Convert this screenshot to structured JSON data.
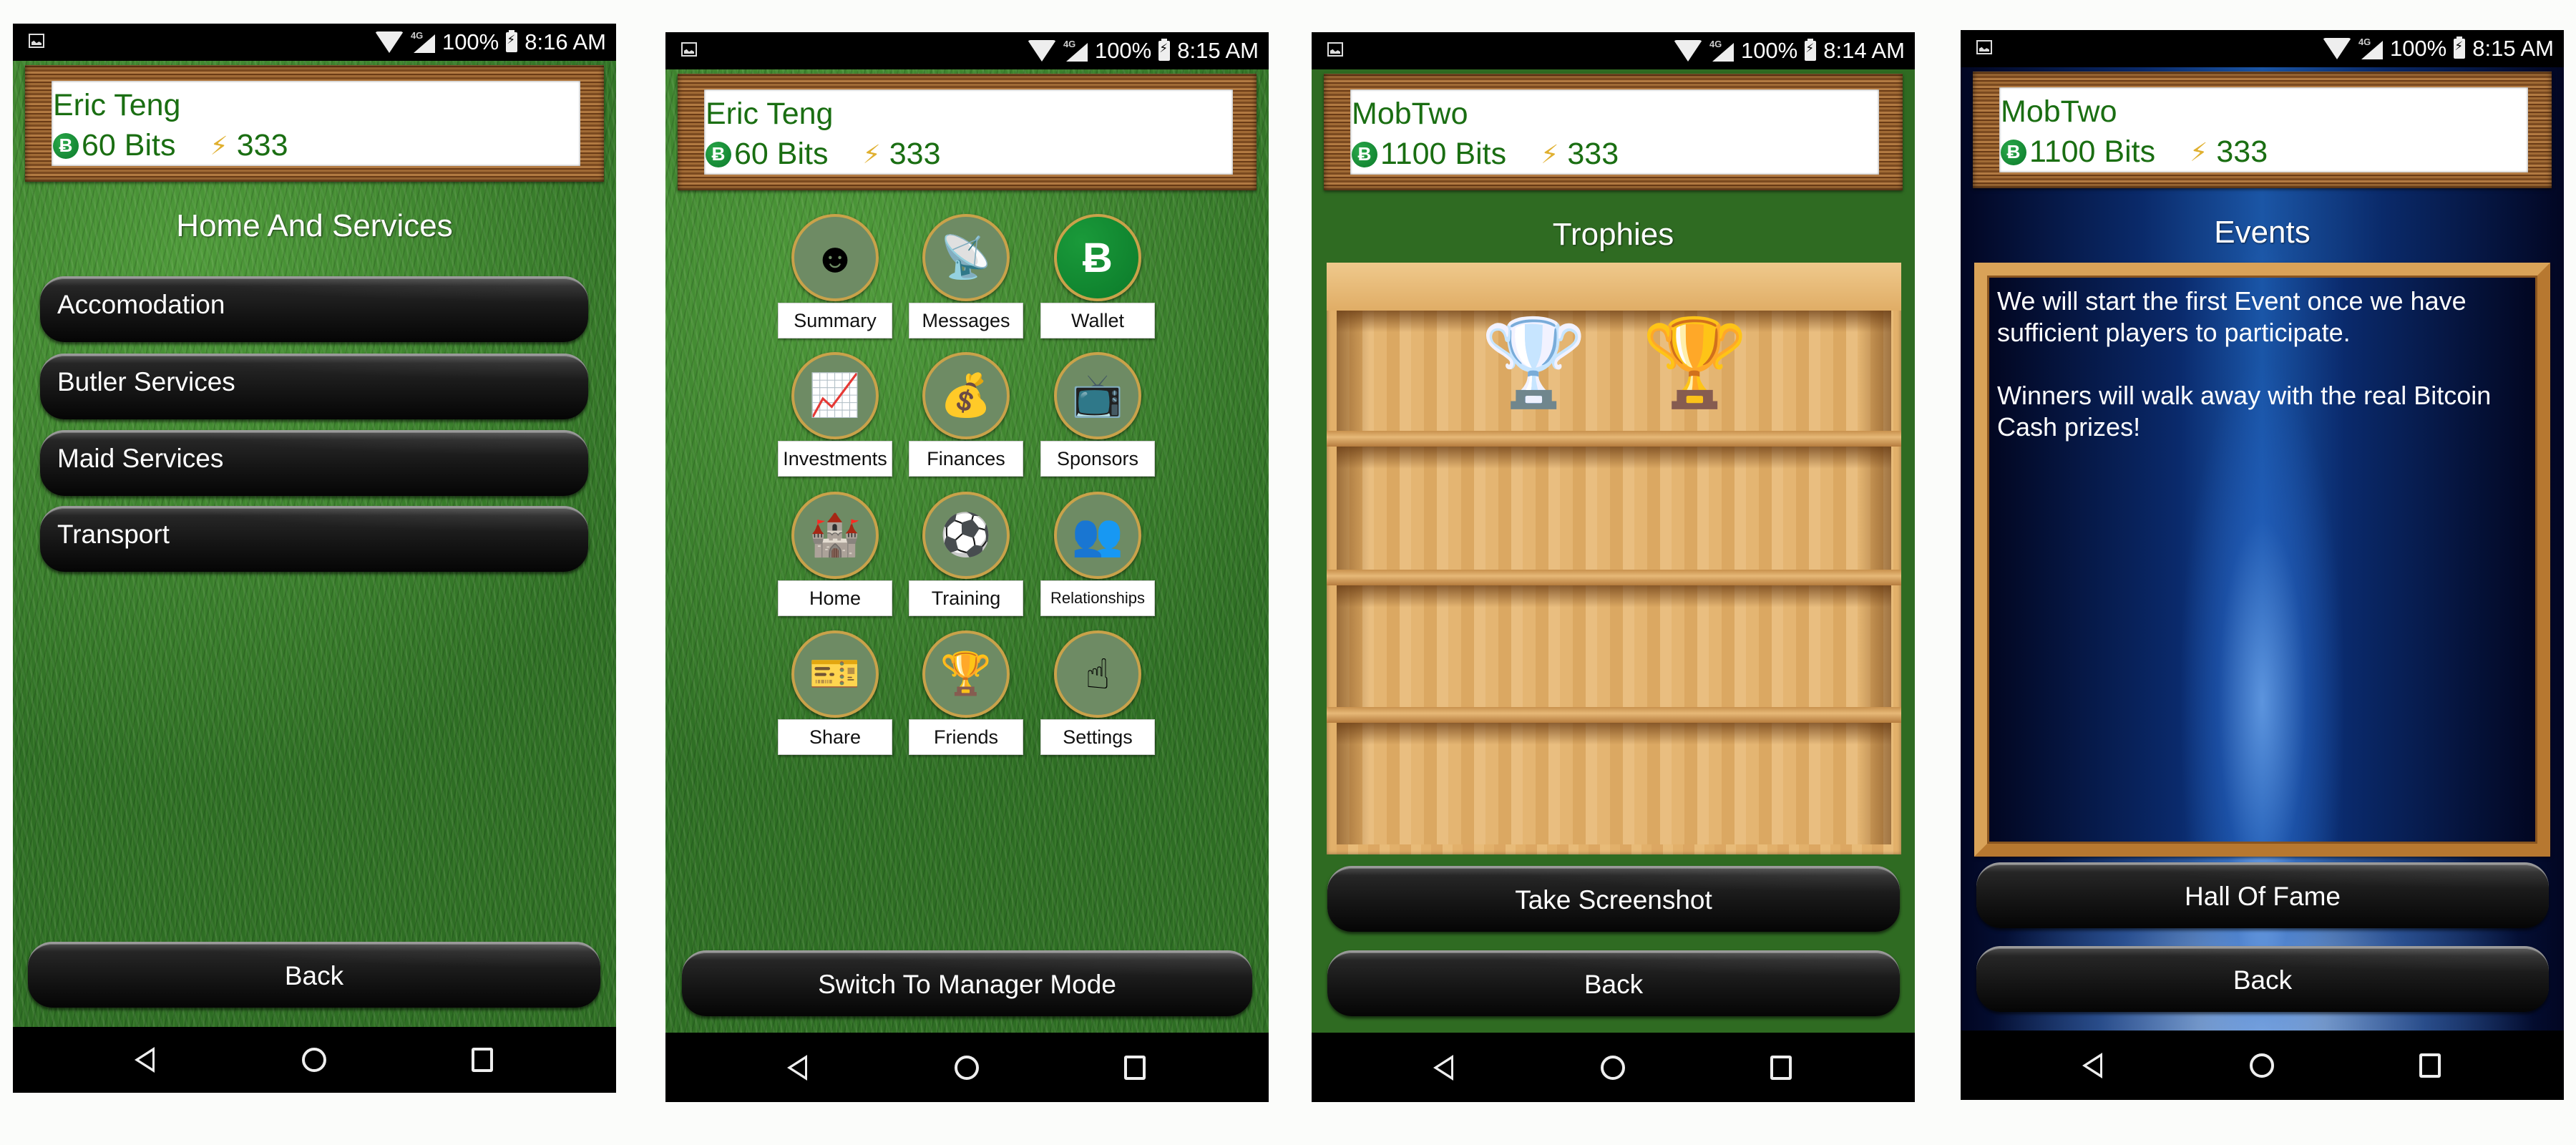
{
  "status_bar": {
    "battery": "100%",
    "network": "4G"
  },
  "screens": [
    {
      "time": "8:16 AM",
      "player": {
        "name": "Eric Teng",
        "bits": "60 Bits",
        "energy": "333"
      },
      "title": "Home And Services",
      "list": [
        "Accomodation",
        "Butler Services",
        "Maid Services",
        "Transport"
      ],
      "back_label": "Back"
    },
    {
      "time": "8:15 AM",
      "player": {
        "name": "Eric Teng",
        "bits": "60 Bits",
        "energy": "333"
      },
      "menu": [
        {
          "label": "Summary",
          "icon": "head-soccer-icon",
          "glyph": "☻"
        },
        {
          "label": "Messages",
          "icon": "satellite-dish-icon",
          "glyph": "📡"
        },
        {
          "label": "Wallet",
          "icon": "bitcoin-icon",
          "glyph": "Ƀ"
        },
        {
          "label": "Investments",
          "icon": "growth-coins-icon",
          "glyph": "📈"
        },
        {
          "label": "Finances",
          "icon": "money-stacks-icon",
          "glyph": "💰"
        },
        {
          "label": "Sponsors",
          "icon": "tv-soccer-icon",
          "glyph": "📺"
        },
        {
          "label": "Home",
          "icon": "mansion-icon",
          "glyph": "🏰"
        },
        {
          "label": "Training",
          "icon": "cone-ball-icon",
          "glyph": "⚽"
        },
        {
          "label": "Relationships",
          "icon": "people-arrow-icon",
          "glyph": "👥"
        },
        {
          "label": "Share",
          "icon": "ticket-icon",
          "glyph": "🎫"
        },
        {
          "label": "Friends",
          "icon": "podium-ball-icon",
          "glyph": "🏆"
        },
        {
          "label": "Settings",
          "icon": "pointing-finger-icon",
          "glyph": "☝"
        }
      ],
      "switch_label": "Switch To Manager Mode"
    },
    {
      "time": "8:14 AM",
      "player": {
        "name": "MobTwo",
        "bits": "1100 Bits",
        "energy": "333"
      },
      "title": "Trophies",
      "trophies": [
        {
          "name": "platinum-trophy",
          "glyph": "🏆"
        },
        {
          "name": "welcome-cup",
          "glyph": "🏆"
        }
      ],
      "screenshot_label": "Take Screenshot",
      "back_label": "Back"
    },
    {
      "time": "8:15 AM",
      "player": {
        "name": "MobTwo",
        "bits": "1100 Bits",
        "energy": "333"
      },
      "title": "Events",
      "message": "We will start the first Event once we have sufficient players to participate.\n\nWinners will walk away with the real Bitcoin Cash prizes!",
      "hall_label": "Hall Of Fame",
      "back_label": "Back"
    }
  ],
  "colors": {
    "name_green": "#1a6e12",
    "trophy_bg_green": "#2f6b22",
    "menu_circle": "#6e8b64",
    "gold_ring": "#c9a24a",
    "bitcoin_green": "#0b7a2a"
  }
}
